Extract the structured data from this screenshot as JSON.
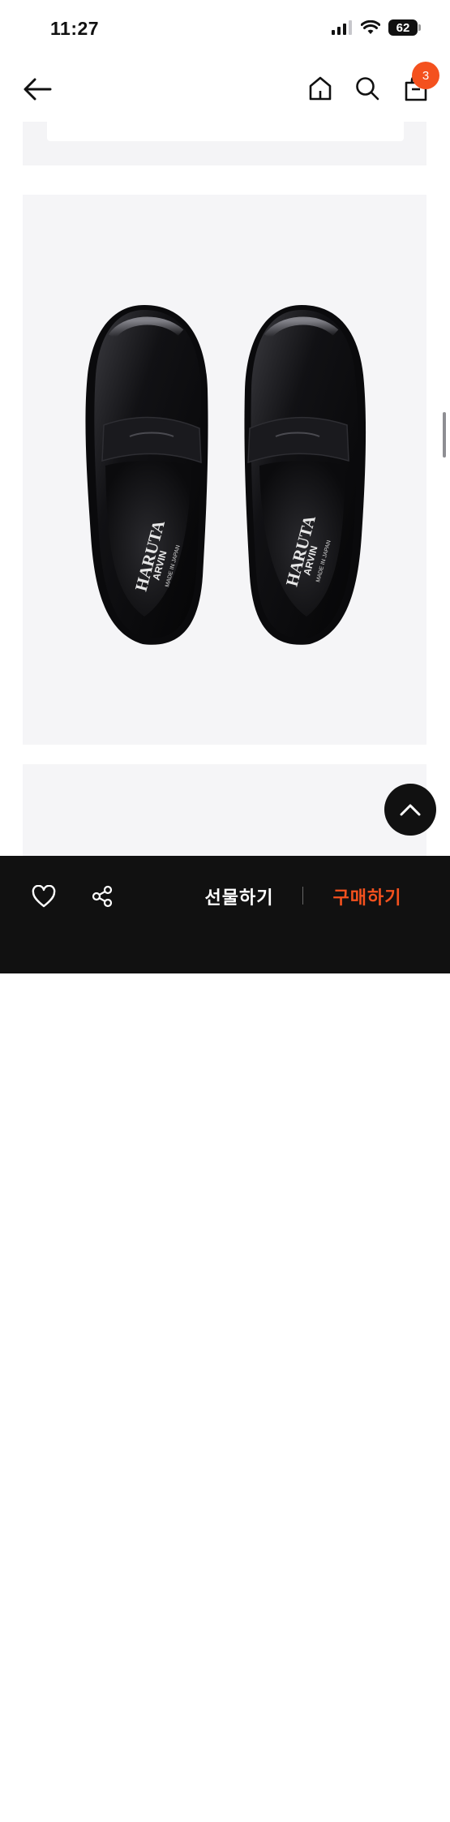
{
  "status_bar": {
    "time": "11:27",
    "battery": "62",
    "icons": [
      "signal-icon",
      "wifi-icon",
      "battery-icon"
    ]
  },
  "top_nav": {
    "icons": [
      "back-arrow-icon",
      "home-icon",
      "search-icon",
      "cart-icon"
    ],
    "cart_count": "3"
  },
  "product_image": {
    "brand_text_left": "HARUTA",
    "sub_text_left": "ARVIN",
    "made_text_left": "MADE IN JAPAN",
    "brand_text_right": "HARUTA",
    "sub_text_right": "ARVIN",
    "made_text_right": "MADE IN JAPAN"
  },
  "bottom_bar": {
    "gift_label": "선물하기",
    "buy_label": "구매하기",
    "icons": [
      "heart-icon",
      "share-icon"
    ]
  },
  "colors": {
    "accent": "#f4511e",
    "bottom_bar_bg": "#111111",
    "image_bg": "#f5f5f7"
  }
}
